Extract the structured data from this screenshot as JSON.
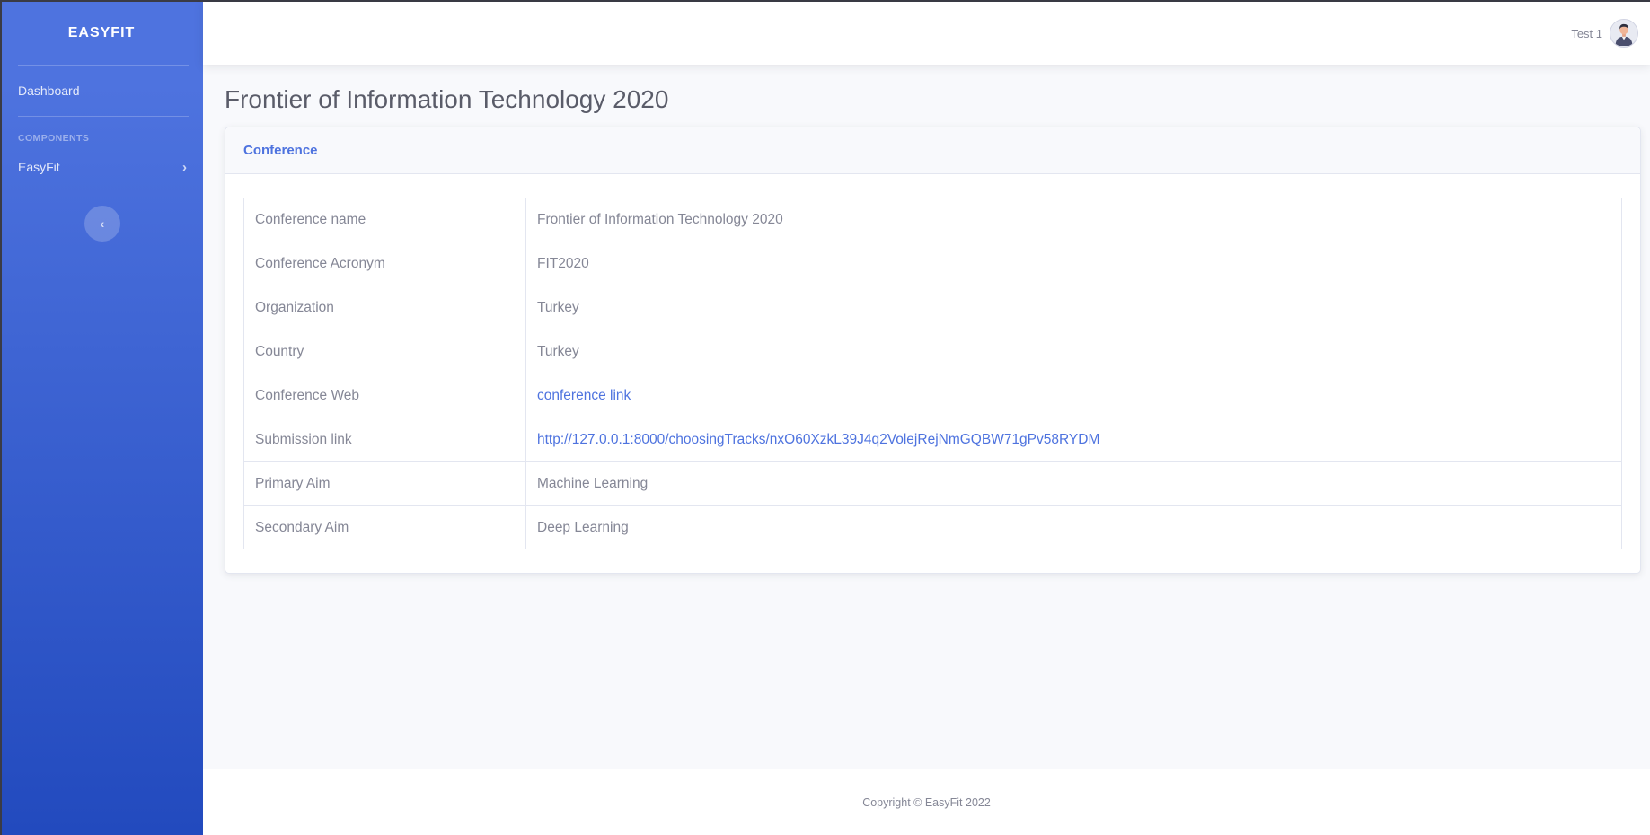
{
  "sidebar": {
    "brand": "EASYFIT",
    "dashboard_label": "Dashboard",
    "components_heading": "COMPONENTS",
    "easyfit_label": "EasyFit",
    "chevron_glyph": "›",
    "toggle_glyph": "‹"
  },
  "topbar": {
    "user_name": "Test 1"
  },
  "page": {
    "title": "Frontier of Information Technology 2020"
  },
  "card": {
    "header": "Conference",
    "rows": [
      {
        "label": "Conference name",
        "value": "Frontier of Information Technology 2020"
      },
      {
        "label": "Conference Acronym",
        "value": "FIT2020"
      },
      {
        "label": "Organization",
        "value": "Turkey"
      },
      {
        "label": "Country",
        "value": "Turkey"
      },
      {
        "label": "Conference Web",
        "value": "conference link"
      },
      {
        "label": "Submission link",
        "value": "http://127.0.0.1:8000/choosingTracks/nxO60XzkL39J4q2VolejRejNmGQBW71gPv58RYDM"
      },
      {
        "label": "Primary Aim",
        "value": "Machine Learning"
      },
      {
        "label": "Secondary Aim",
        "value": "Deep Learning"
      }
    ]
  },
  "footer": {
    "copyright": "Copyright © EasyFit 2022"
  },
  "colors": {
    "primary": "#4e73df",
    "sidebar_gradient_end": "#224abe",
    "text_muted": "#858796",
    "background": "#f8f9fc"
  }
}
